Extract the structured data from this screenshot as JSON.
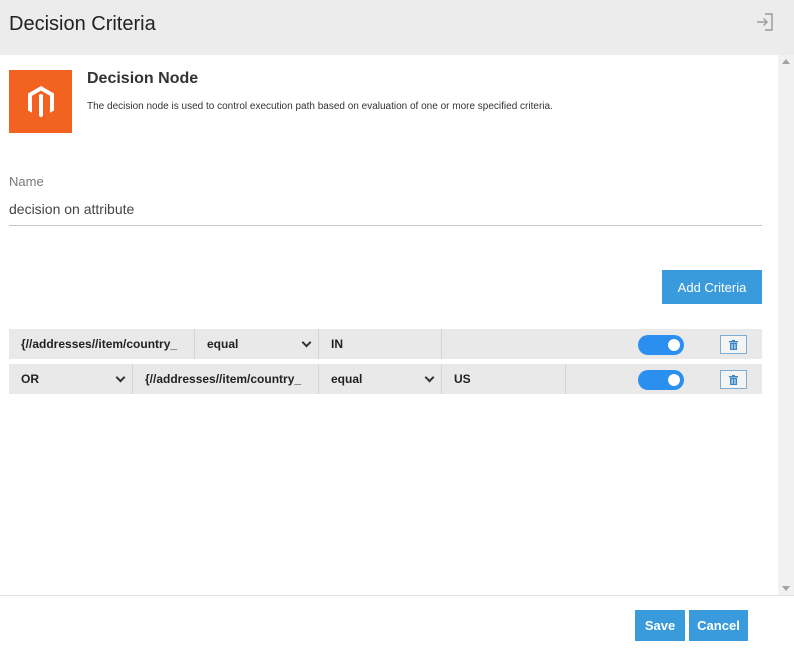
{
  "header": {
    "title": "Decision Criteria",
    "exit_icon": "exit-icon"
  },
  "node": {
    "title": "Decision Node",
    "description": "The decision node is used to control execution path based on evaluation of one or more specified criteria.",
    "logo_icon": "magento-logo",
    "logo_color": "#f26322"
  },
  "name_field": {
    "label": "Name",
    "value": "decision on attribute"
  },
  "add_criteria_label": "Add Criteria",
  "criteria": [
    {
      "attribute": "{//addresses//item/country_",
      "operator": "equal",
      "value": "IN",
      "enabled": true
    },
    {
      "logic": "OR",
      "attribute": "{//addresses//item/country_",
      "operator": "equal",
      "value": "US",
      "enabled": true
    }
  ],
  "footer": {
    "save_label": "Save",
    "cancel_label": "Cancel"
  },
  "colors": {
    "accent": "#3a9bdc",
    "toggle": "#2b8ff0",
    "header_bg": "#ececec",
    "row_bg": "#e9e9e9"
  }
}
